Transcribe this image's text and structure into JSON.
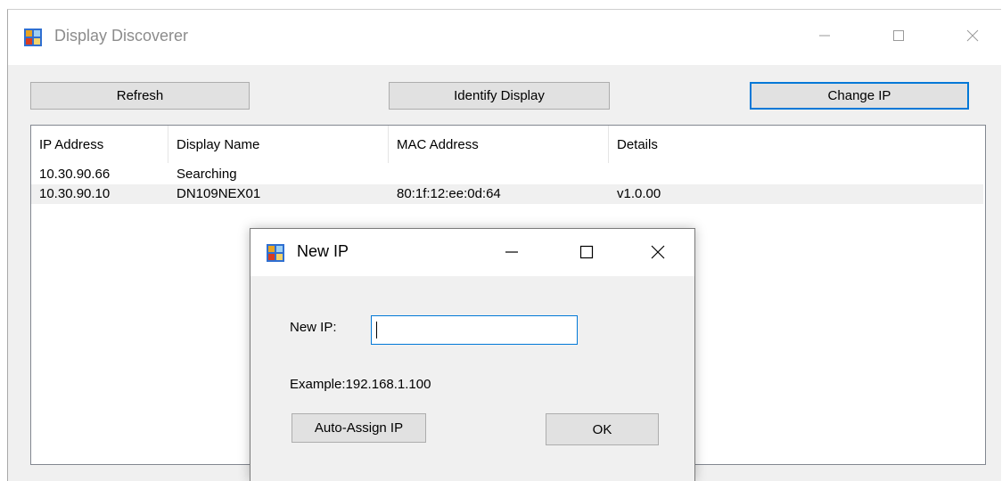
{
  "window": {
    "title": "Display Discoverer",
    "controls": {
      "minimize": "minimize-icon",
      "maximize": "maximize-icon",
      "close": "close-icon"
    }
  },
  "toolbar": {
    "refresh_label": "Refresh",
    "identify_label": "Identify Display",
    "change_ip_label": "Change IP"
  },
  "table": {
    "columns": [
      "IP Address",
      "Display Name",
      "MAC Address",
      "Details"
    ],
    "rows": [
      {
        "ip": "10.30.90.66",
        "name": "Searching",
        "mac": "",
        "details": ""
      },
      {
        "ip": "10.30.90.10",
        "name": "DN109NEX01",
        "mac": "80:1f:12:ee:0d:64",
        "details": "v1.0.00"
      }
    ]
  },
  "dialog": {
    "title": "New IP",
    "new_ip_label": "New IP:",
    "new_ip_value": "",
    "example_text": "Example:192.168.1.100",
    "auto_assign_label": "Auto-Assign IP",
    "ok_label": "OK"
  },
  "colors": {
    "accent": "#0078d7",
    "window_bg": "#f0f0f0",
    "button_bg": "#e1e1e1",
    "selected_row_bg": "#f0f0f0"
  }
}
